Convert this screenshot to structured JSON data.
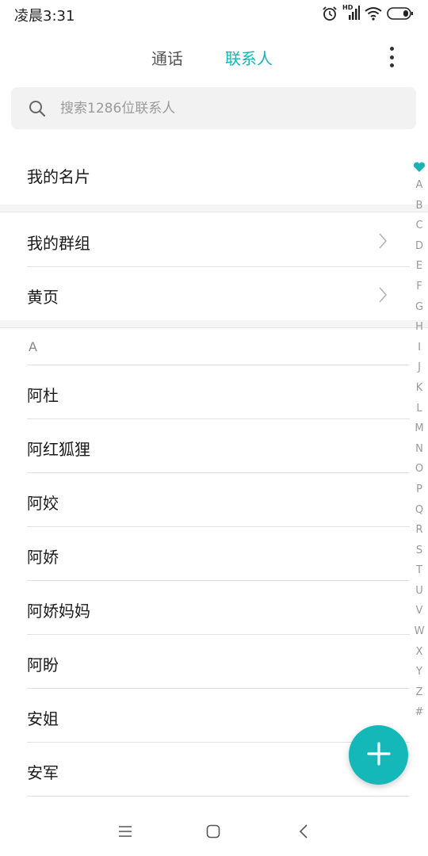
{
  "status_bar": {
    "time": "凌晨3:31",
    "network_badge": "HD",
    "icons": [
      "alarm-icon",
      "signal-icon",
      "wifi-icon",
      "battery-icon"
    ]
  },
  "tabs": [
    {
      "label": "通话",
      "active": false
    },
    {
      "label": "联系人",
      "active": true
    }
  ],
  "accent_color": "#1ab3b3",
  "search": {
    "placeholder": "搜索1286位联系人",
    "value": ""
  },
  "my_card": {
    "label": "我的名片"
  },
  "groups": [
    {
      "label": "我的群组"
    },
    {
      "label": "黄页"
    }
  ],
  "section_letter": "A",
  "contacts": [
    {
      "name": "阿杜"
    },
    {
      "name": "阿红狐狸"
    },
    {
      "name": "阿姣"
    },
    {
      "name": "阿娇"
    },
    {
      "name": "阿娇妈妈"
    },
    {
      "name": "阿盼"
    },
    {
      "name": "安姐"
    },
    {
      "name": "安军"
    }
  ],
  "alpha_index": [
    "A",
    "B",
    "C",
    "D",
    "E",
    "F",
    "G",
    "H",
    "I",
    "J",
    "K",
    "L",
    "M",
    "N",
    "O",
    "P",
    "Q",
    "R",
    "S",
    "T",
    "U",
    "V",
    "W",
    "X",
    "Y",
    "Z",
    "#"
  ],
  "fab": {
    "icon": "plus-icon"
  },
  "nav_buttons": [
    "menu-icon",
    "home-icon",
    "back-icon"
  ]
}
